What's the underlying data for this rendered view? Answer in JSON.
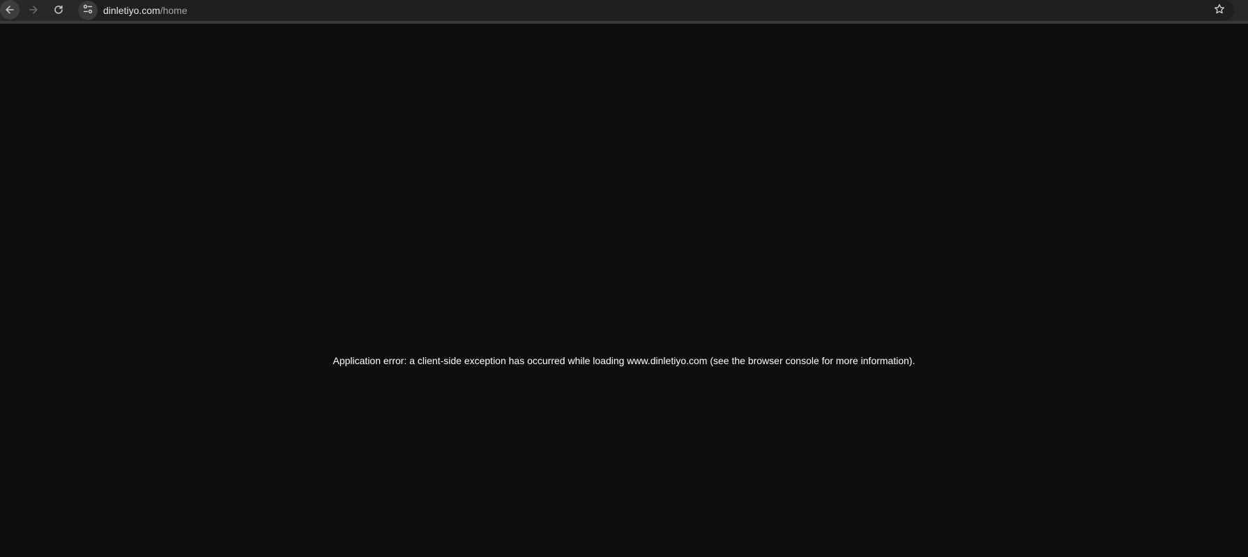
{
  "browser": {
    "url_host": "dinletiyo.com",
    "url_path": "/home",
    "icons": {
      "back": "arrow-left-icon",
      "forward": "arrow-right-icon",
      "reload": "reload-icon",
      "site_info": "tune-icon",
      "bookmark": "star-icon"
    }
  },
  "page": {
    "error_message": "Application error: a client-side exception has occurred while loading www.dinletiyo.com (see the browser console for more information)."
  },
  "colors": {
    "page_background": "#0e0e0e",
    "toolbar_background": "#282828",
    "text": "#ffffff"
  }
}
